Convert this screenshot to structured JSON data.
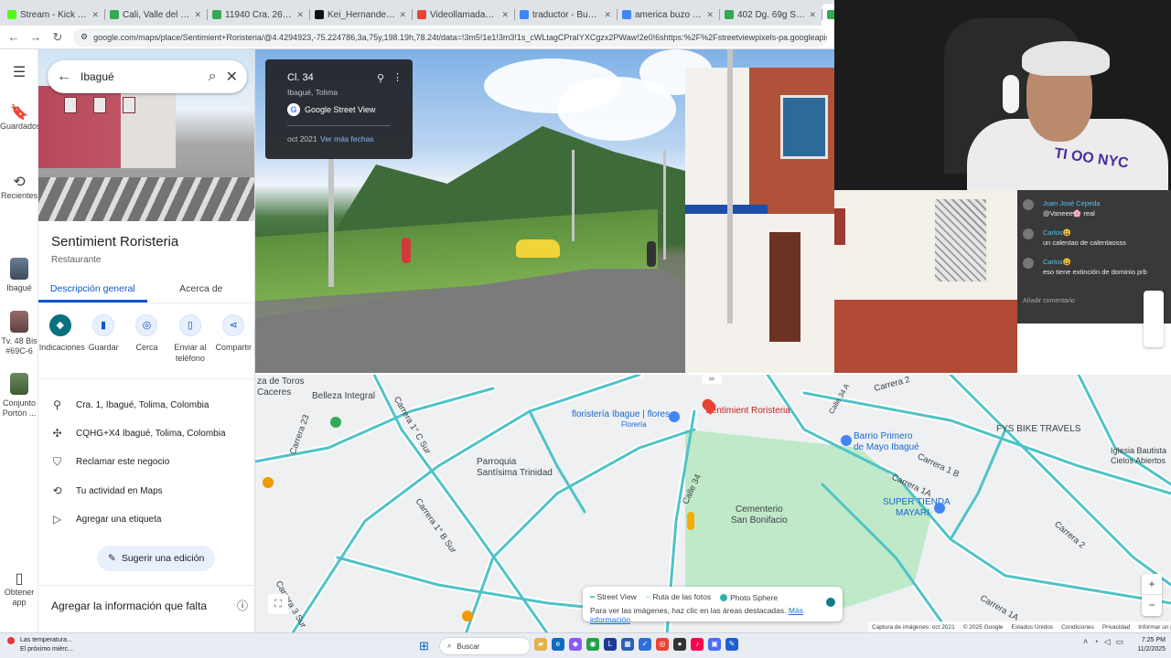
{
  "browser": {
    "tabs": [
      {
        "label": "Stream - Kick Dashboard",
        "color": "#53fc18"
      },
      {
        "label": "Cali, Valle del Cauca - Google Maps",
        "color": "#34a853"
      },
      {
        "label": "11940 Cra. 26b 3 - Google Maps",
        "color": "#34a853"
      },
      {
        "label": "Kei_Hernandez.0 (@kei_hvman)",
        "color": "#111111"
      },
      {
        "label": "Videollamadas OmeTV — 4",
        "color": "#ea4335"
      },
      {
        "label": "traductor - Buscar con Google",
        "color": "#4285f4"
      },
      {
        "label": "america buzo rojo con negro ha",
        "color": "#4285f4"
      },
      {
        "label": "402 Dg. 69g Sur - Google Maps",
        "color": "#34a853"
      },
      {
        "label": "G",
        "color": "#34a853"
      }
    ],
    "url": "google.com/maps/place/Sentimient+Roristeria/@4.4294923,-75.224786,3a,75y,198.19h,78.24t/data=!3m5!1e1!3m3!1s_cWLtagCPraIYXCgzx2PWaw!2e0!6shttps:%2F%2Fstreetviewpixels-pa.googleapis.com%2Fv1%2Fthumbnail%3Fcb_client%3Dmaps_sv.tactile%26w%3D900%26h%3D600%26pitc"
  },
  "rail": {
    "saved": "Guardados",
    "recent": "Recientes",
    "history": [
      {
        "label": "Ibagué"
      },
      {
        "label": "Tv. 48 Bis #69C-6"
      },
      {
        "label": "Conjunto Portón ..."
      }
    ],
    "get_app": "Obtener app"
  },
  "panel": {
    "search_value": "Ibagué",
    "title": "Sentimient Roristeria",
    "type": "Restaurante",
    "tabs": [
      "Descripción general",
      "Acerca de"
    ],
    "actions": [
      {
        "label": "Indicaciones",
        "icon": "directions-icon"
      },
      {
        "label": "Guardar",
        "icon": "bookmark-icon"
      },
      {
        "label": "Cerca",
        "icon": "nearby-icon"
      },
      {
        "label": "Enviar al teléfono",
        "icon": "phone-icon"
      },
      {
        "label": "Compartir",
        "icon": "share-icon"
      }
    ],
    "info": [
      {
        "icon": "location-icon",
        "text": "Cra. 1, Ibagué, Tolima, Colombia"
      },
      {
        "icon": "plus-code-icon",
        "text": "CQHG+X4 Ibagué, Tolima, Colombia"
      },
      {
        "icon": "shield-icon",
        "text": "Reclamar este negocio"
      },
      {
        "icon": "history-icon",
        "text": "Tu actividad en Maps"
      },
      {
        "icon": "label-icon",
        "text": "Agregar una etiqueta"
      }
    ],
    "suggest_edit": "Sugerir una edición",
    "add_info": "Agregar la información que falta"
  },
  "streetview": {
    "title": "Cl. 34",
    "subtitle": "Ibagué, Tolima",
    "brand": "Google Street View",
    "date": "oct 2021",
    "more_dates": "Ver más fechas"
  },
  "chat": [
    {
      "user": "Juan José Cepeda",
      "text": "@Vaneee🌸 real",
      "color": "#4fc3f7"
    },
    {
      "user": "Carlos😃",
      "text": "un calentao de calentaosss",
      "color": "#4fc3f7"
    },
    {
      "user": "Carlos😃",
      "text": "eso tiene extinción de dominio prb",
      "color": "#4fc3f7"
    }
  ],
  "chat_input_placeholder": "Añadir comentario",
  "webcam": {
    "shirt_text": "TI OO NYC"
  },
  "map": {
    "labels": {
      "plaza": "za de Toros",
      "caceres": "Caceres",
      "belleza": "Belleza Integral",
      "floristeria": "floristería Ibague | flores",
      "floreria": "Florería",
      "place": "Sentimient Roristeria",
      "barrio1": "Barrio Primero",
      "barrio2": "de Mayo Ibagué",
      "bike": "FYS BIKE TRAVELS",
      "iglesia1": "Iglesia Bautista",
      "iglesia2": "Cielos Abiertos",
      "parroquia1": "Parroquia",
      "parroquia2": "Santísima Trinidad",
      "cementerio1": "Cementerio",
      "cementerio2": "San Bonifacio",
      "supertienda1": "SUPER TIENDA",
      "supertienda2": "MAYARI"
    },
    "roads": {
      "carrera2": "Carrera 2",
      "carrera1c": "Carrera 1° C Sur",
      "carrera1b": "Carrera 1° B Sur",
      "carrera3": "Carrera 3 Sur",
      "carrera23": "Carrera 23",
      "calle34": "Calle 34",
      "calle34a": "Calle 34 A",
      "carrera1a": "Carrera 1A",
      "carrera1b2": "Carrera 1 B",
      "carrera2b": "Carrera 2",
      "carrera1a2": "Carrera 1A"
    },
    "legend": {
      "street_view": "Street View",
      "photo_path": "Ruta de las fotos",
      "photo_sphere": "Photo Sphere",
      "hint": "Para ver las imágenes, haz clic en las áreas destacadas.",
      "more": "Más información"
    },
    "footer": [
      "Captura de imágenes: oct 2021",
      "© 2025 Google",
      "Estados Unidos",
      "Condiciones",
      "Privacidad",
      "Informar un problema"
    ]
  },
  "taskbar": {
    "weather_title": "Las temperatura...",
    "weather_sub": "El próximo miérc...",
    "search_placeholder": "Buscar",
    "time": "7:25 PM",
    "date": "11/2/2025"
  }
}
